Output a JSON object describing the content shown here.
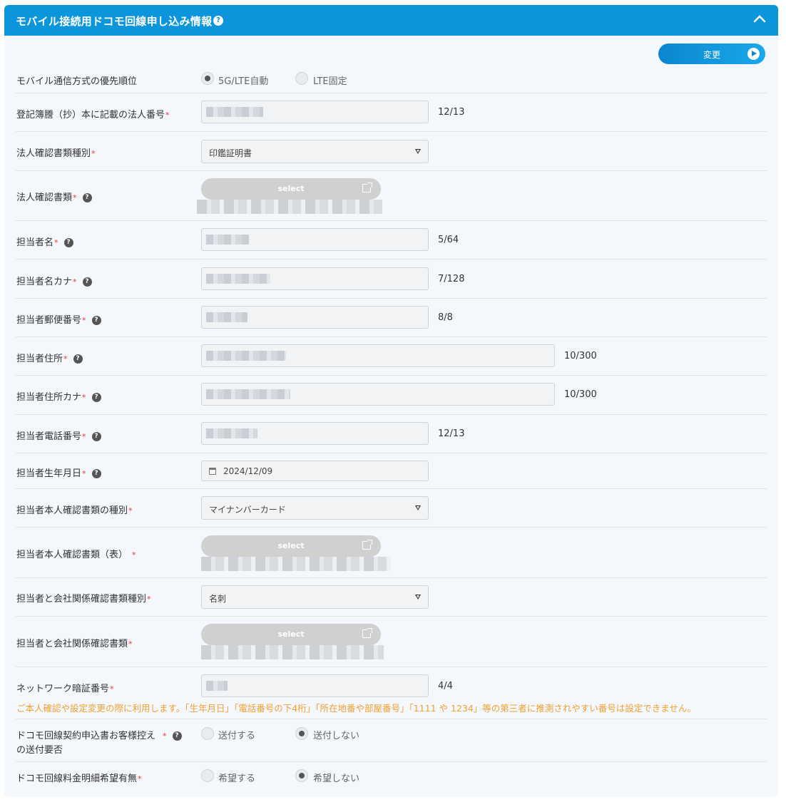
{
  "header": {
    "title": "モバイル接続用ドコモ回線申し込み情報",
    "help": "?"
  },
  "change_button": {
    "label": "変更"
  },
  "fields": {
    "mobile_priority": {
      "label": "モバイル通信方式の優先順位",
      "options": [
        "5G/LTE自動",
        "LTE固定"
      ],
      "selected": "5G/LTE自動"
    },
    "corp_number": {
      "label": "登記簿謄（抄）本に記載の法人番号",
      "counter": "12/13"
    },
    "corp_doc_type": {
      "label": "法人確認書類種別",
      "value": "印鑑証明書"
    },
    "corp_doc": {
      "label": "法人確認書類",
      "button": "select"
    },
    "contact_name": {
      "label": "担当者名",
      "counter": "5/64"
    },
    "contact_kana": {
      "label": "担当者名カナ",
      "counter": "7/128"
    },
    "contact_zip": {
      "label": "担当者郵便番号",
      "counter": "8/8"
    },
    "contact_address": {
      "label": "担当者住所",
      "counter": "10/300"
    },
    "contact_address_kana": {
      "label": "担当者住所カナ",
      "counter": "10/300"
    },
    "contact_phone": {
      "label": "担当者電話番号",
      "counter": "12/13"
    },
    "contact_birthdate": {
      "label": "担当者生年月日",
      "value": "2024/12/09"
    },
    "contact_id_type": {
      "label": "担当者本人確認書類の種別",
      "value": "マイナンバーカード"
    },
    "contact_id_front": {
      "label": "担当者本人確認書類（表）",
      "button": "select"
    },
    "relation_doc_type": {
      "label": "担当者と会社関係確認書類種別",
      "value": "名刺"
    },
    "relation_doc": {
      "label": "担当者と会社関係確認書類",
      "button": "select"
    },
    "network_pin": {
      "label": "ネットワーク暗証番号",
      "counter": "4/4",
      "note": "ご本人確認や設定変更の際に利用します。「生年月日」「電話番号の下4桁」「所在地番や部屋番号」「1111 や 1234」等の第三者に推測されやすい番号は設定できません。"
    },
    "send_copy": {
      "label_line1": "ドコモ回線契約申込書お客様控え",
      "label_line2": "の送付要否",
      "options": [
        "送付する",
        "送付しない"
      ],
      "selected": "送付しない"
    },
    "detail_bill": {
      "label": "ドコモ回線料金明細希望有無",
      "options": [
        "希望する",
        "希望しない"
      ],
      "selected": "希望しない"
    }
  },
  "required_mark": "*",
  "help_mark": "?"
}
